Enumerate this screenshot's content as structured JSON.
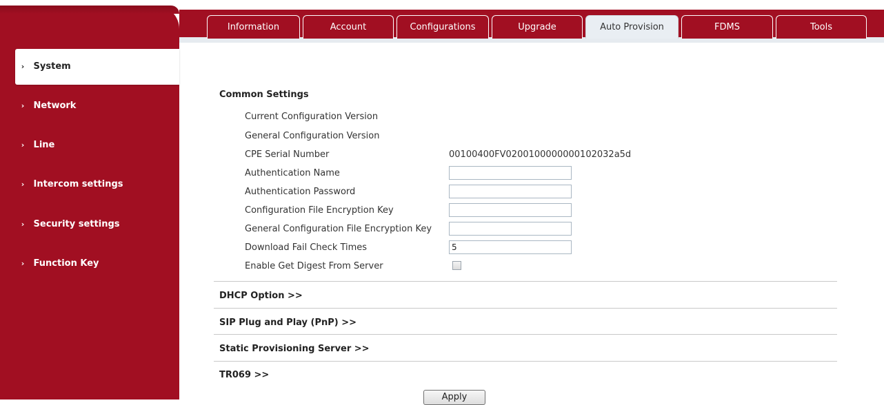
{
  "tabs": [
    {
      "label": "Information"
    },
    {
      "label": "Account"
    },
    {
      "label": "Configurations"
    },
    {
      "label": "Upgrade"
    },
    {
      "label": "Auto Provision"
    },
    {
      "label": "FDMS"
    },
    {
      "label": "Tools"
    }
  ],
  "active_tab": "Auto Provision",
  "sidebar": {
    "items": [
      {
        "label": "System"
      },
      {
        "label": "Network"
      },
      {
        "label": "Line"
      },
      {
        "label": "Intercom settings"
      },
      {
        "label": "Security settings"
      },
      {
        "label": "Function Key"
      }
    ],
    "active": "System",
    "chevron": "›"
  },
  "common_settings": {
    "title": "Common Settings",
    "current_config_version_label": "Current Configuration Version",
    "general_config_version_label": "General Configuration Version",
    "cpe_serial_label": "CPE Serial Number",
    "cpe_serial_value": "00100400FV0200100000000102032a5d",
    "auth_name_label": "Authentication Name",
    "auth_name_value": "",
    "auth_password_label": "Authentication Password",
    "auth_password_value": "",
    "config_key_label": "Configuration File Encryption Key",
    "config_key_value": "",
    "general_config_key_label": "General Configuration File Encryption Key",
    "general_config_key_value": "",
    "download_fail_label": "Download Fail Check Times",
    "download_fail_value": "5",
    "digest_label": "Enable Get Digest From Server",
    "digest_checked": false
  },
  "sections": {
    "dhcp": "DHCP Option >>",
    "sip_pnp": "SIP Plug and Play (PnP) >>",
    "static_server": "Static Provisioning Server >>",
    "tr069": "TR069 >>"
  },
  "apply_label": "Apply",
  "colors": {
    "brand_red": "#a10f22",
    "active_tab_bg": "#e9eef3"
  }
}
